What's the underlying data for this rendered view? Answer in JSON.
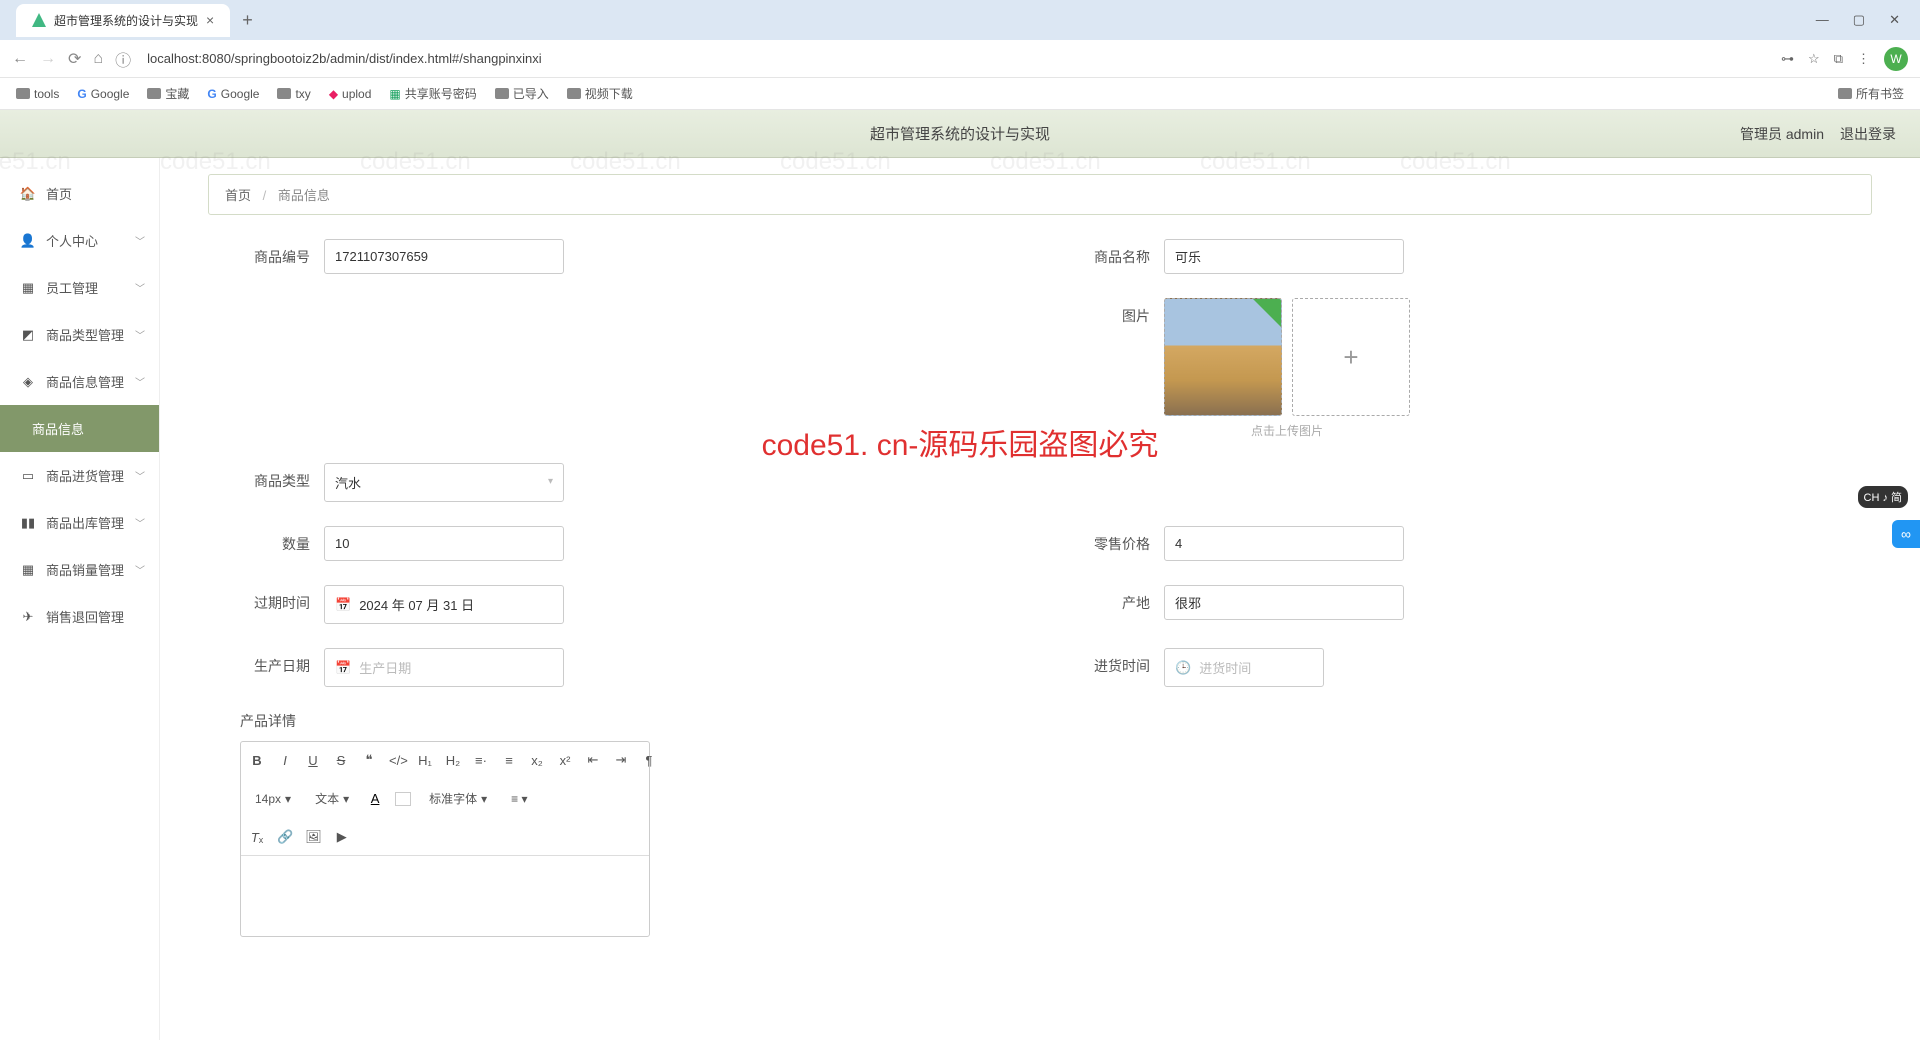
{
  "browser": {
    "tab_title": "超市管理系统的设计与实现",
    "url": "localhost:8080/springbootoiz2b/admin/dist/index.html#/shangpinxinxi",
    "user_initial": "W"
  },
  "bookmarks": [
    "tools",
    "Google",
    "宝藏",
    "Google",
    "txy",
    "uplod",
    "共享账号密码",
    "已导入",
    "视频下载"
  ],
  "bookmarks_right": "所有书签",
  "header": {
    "title": "超市管理系统的设计与实现",
    "user": "管理员 admin",
    "logout": "退出登录"
  },
  "sidebar": {
    "items": [
      {
        "label": "首页"
      },
      {
        "label": "个人中心",
        "expand": true
      },
      {
        "label": "员工管理",
        "expand": true
      },
      {
        "label": "商品类型管理",
        "expand": true
      },
      {
        "label": "商品信息管理",
        "expand": true
      },
      {
        "label": "商品信息",
        "active": true,
        "sub": true
      },
      {
        "label": "商品进货管理",
        "expand": true
      },
      {
        "label": "商品出库管理",
        "expand": true
      },
      {
        "label": "商品销量管理",
        "expand": true
      },
      {
        "label": "销售退回管理"
      }
    ]
  },
  "breadcrumb": {
    "home": "首页",
    "current": "商品信息"
  },
  "form": {
    "code_label": "商品编号",
    "code_value": "1721107307659",
    "name_label": "商品名称",
    "name_value": "可乐",
    "img_label": "图片",
    "img_hint": "点击上传图片",
    "type_label": "商品类型",
    "type_value": "汽水",
    "qty_label": "数量",
    "qty_value": "10",
    "price_label": "零售价格",
    "price_value": "4",
    "expire_label": "过期时间",
    "expire_value": "2024 年 07 月 31 日",
    "origin_label": "产地",
    "origin_value": "很邪",
    "prod_label": "生产日期",
    "prod_ph": "生产日期",
    "stock_label": "进货时间",
    "stock_ph": "进货时间",
    "detail_label": "产品详情"
  },
  "editor": {
    "font_size": "14px",
    "font_type": "文本",
    "font_family": "标准字体"
  },
  "watermark": "code51. cn-源码乐园盗图必究",
  "wm_text": "code51.cn",
  "ime": "CH ♪ 简"
}
